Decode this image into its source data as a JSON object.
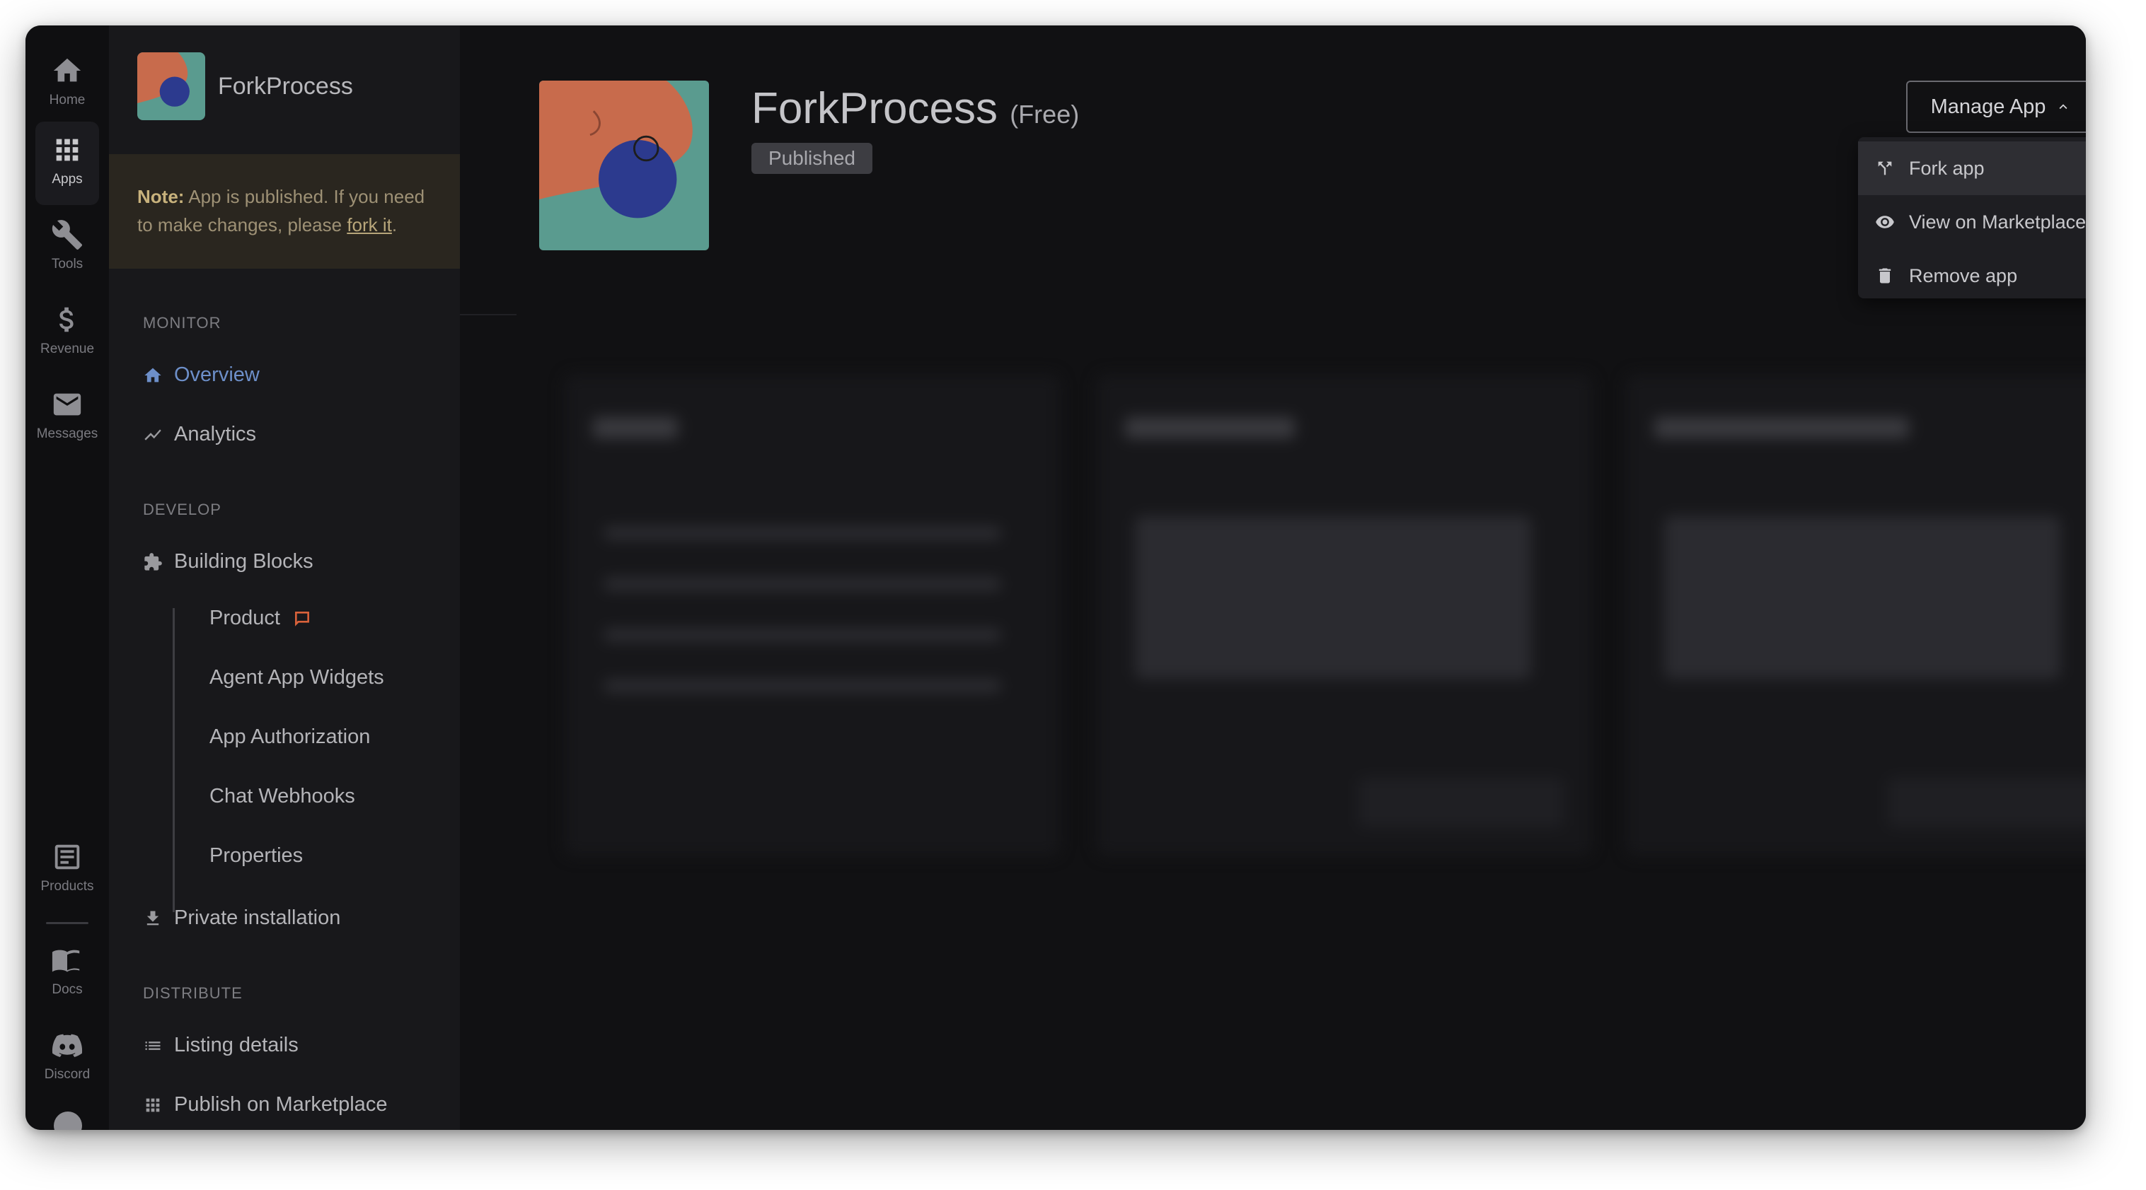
{
  "rail": {
    "home": "Home",
    "apps": "Apps",
    "tools": "Tools",
    "revenue": "Revenue",
    "messages": "Messages",
    "products": "Products",
    "docs": "Docs",
    "discord": "Discord"
  },
  "app": {
    "name": "ForkProcess",
    "plan": "(Free)",
    "status": "Published"
  },
  "note": {
    "label": "Note:",
    "text_before": "App is published. If you need to make changes, please",
    "link": "fork it",
    "text_after": "."
  },
  "sidebar": {
    "monitor": "MONITOR",
    "overview": "Overview",
    "analytics": "Analytics",
    "develop": "DEVELOP",
    "building_blocks": "Building Blocks",
    "sub": [
      "Product",
      "Agent App Widgets",
      "App Authorization",
      "Chat Webhooks",
      "Properties"
    ],
    "private_installation": "Private installation",
    "distribute": "DISTRIBUTE",
    "listing_details": "Listing details",
    "publish": "Publish on Marketplace"
  },
  "manage": {
    "button": "Manage App",
    "items": [
      "Fork app",
      "View on Marketplace",
      "Remove app"
    ]
  },
  "colors": {
    "accent": "#6d8fc9",
    "note_bg": "#2a261f",
    "thumb_teal": "#5a9b8f",
    "thumb_orange": "#c86b4c",
    "thumb_blue": "#2c3a8e"
  }
}
